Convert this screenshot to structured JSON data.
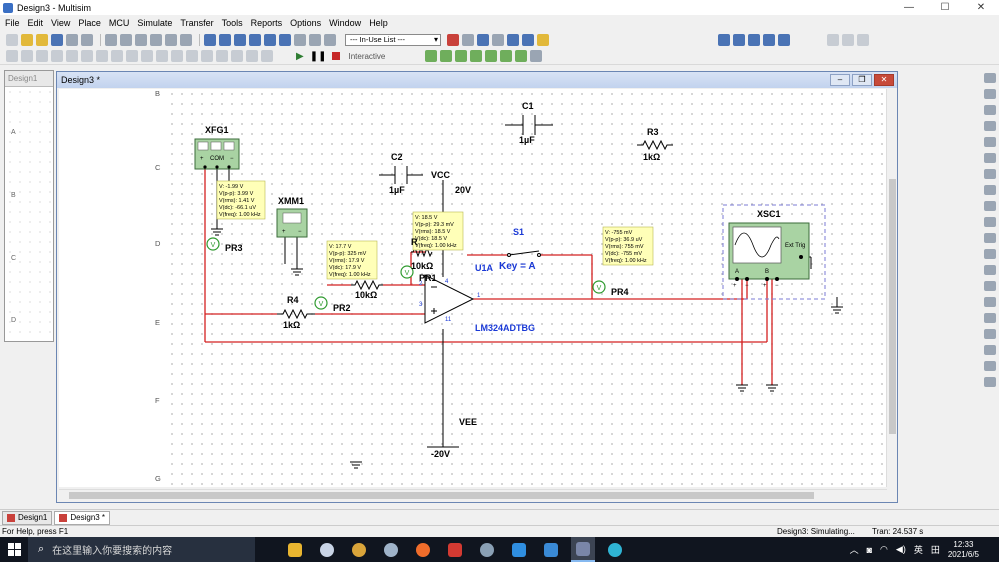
{
  "window": {
    "title": "Design3 - Multisim",
    "minimize": "—",
    "maximize": "☐",
    "close": "✕"
  },
  "menu": [
    "File",
    "Edit",
    "View",
    "Place",
    "MCU",
    "Simulate",
    "Transfer",
    "Tools",
    "Reports",
    "Options",
    "Window",
    "Help"
  ],
  "toolbar": {
    "in_use_list": "--- In-Use List ---",
    "interactive": "Interactive"
  },
  "left_panel": {
    "tab": "Design1",
    "rows": [
      "A",
      "B",
      "C",
      "D"
    ]
  },
  "child_window": {
    "title": "Design3 *"
  },
  "ruler_rows": [
    "B",
    "C",
    "D",
    "E",
    "F",
    "G"
  ],
  "schematic": {
    "xfg": {
      "ref": "XFG1",
      "com": "COM",
      "signs": [
        "+",
        "−"
      ]
    },
    "xmm": {
      "ref": "XMM1",
      "signs": [
        "+",
        "−"
      ]
    },
    "xsc": {
      "ref": "XSC1",
      "ext_trig": "Ext Trig",
      "ch_a": "A",
      "ch_b": "B",
      "ch_signs": [
        "+",
        "−"
      ]
    },
    "c1": {
      "ref": "C1",
      "value": "1µF"
    },
    "c2": {
      "ref": "C2",
      "value": "1µF"
    },
    "r3": {
      "ref": "R3",
      "value": "1kΩ"
    },
    "r4": {
      "ref": "R4",
      "value": "1kΩ"
    },
    "r_mid": {
      "value": "10kΩ"
    },
    "r_fb": {
      "ref": "R",
      "value": "10kΩ"
    },
    "vcc": {
      "label": "VCC",
      "value": "20V"
    },
    "vee": {
      "label": "VEE",
      "value": "-20V"
    },
    "s1": {
      "ref": "S1",
      "key": "Key = A"
    },
    "u1": {
      "ref": "U1A",
      "part": "LM324ADTBG",
      "pins": [
        "3",
        "2",
        "4",
        "11",
        "1"
      ]
    },
    "probes": {
      "pr1": {
        "name": "PR1",
        "lines": [
          "V: 18.5 V",
          "V(p-p): 29.3 mV",
          "V(rms): 18.5 V",
          "V(dc): 18.5 V",
          "V(freq): 1.00 kHz"
        ]
      },
      "pr2": {
        "name": "PR2",
        "lines": [
          "V: 17.7 V",
          "V(p-p): 325 mV",
          "V(rms): 17.9 V",
          "V(dc): 17.9 V",
          "V(freq): 1.00 kHz"
        ]
      },
      "pr3": {
        "name": "PR3",
        "lines": [
          "V: -1.99 V",
          "V(p-p): 3.99 V",
          "V(rms): 1.41 V",
          "V(dc): -66.1 uV",
          "V(freq): 1.00 kHz"
        ]
      },
      "pr4": {
        "name": "PR4",
        "lines": [
          "V: -755 mV",
          "V(p-p): 36.9 uV",
          "V(rms): 755 mV",
          "V(dc): -755 mV",
          "V(freq): 1.00 kHz"
        ]
      }
    },
    "probe_glyph": "V"
  },
  "bottom_tabs": [
    "Design1",
    "Design3 *"
  ],
  "status": {
    "help": "For Help, press F1",
    "sim": "Design3: Simulating...",
    "tran": "Tran: 24.537 s"
  },
  "taskbar": {
    "search_placeholder": "在这里输入你要搜索的内容",
    "tray_lang": "英",
    "tray_grid": "田",
    "time": "12:33",
    "date": "2021/6/5"
  },
  "colors": {
    "wire": "#d42020",
    "probe_box": "#ffffb8",
    "blue_label": "#1a39d6",
    "sim_run": "#2e7d32"
  }
}
